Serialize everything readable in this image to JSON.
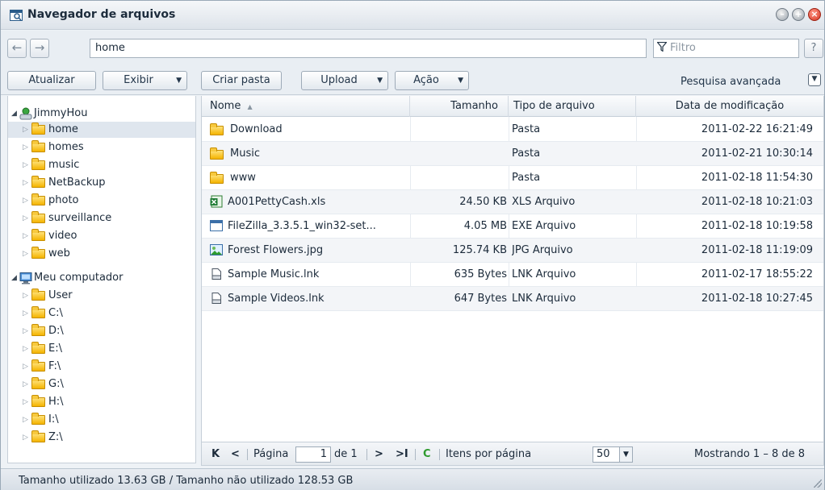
{
  "window": {
    "title": "Navegador de arquivos"
  },
  "address_bar": {
    "back_symbol": "←",
    "forward_symbol": "→",
    "path": "home",
    "filter_placeholder": "Filtro",
    "help_symbol": "?"
  },
  "toolbar": {
    "refresh_label": "Atualizar",
    "view_label": "Exibir",
    "new_folder_label": "Criar pasta",
    "upload_label": "Upload",
    "action_label": "Ação",
    "advanced_search_label": "Pesquisa avançada"
  },
  "tree": {
    "roots": [
      {
        "label": "JimmyHou",
        "icon": "network-user-icon",
        "children": [
          "home",
          "homes",
          "music",
          "NetBackup",
          "photo",
          "surveillance",
          "video",
          "web"
        ],
        "selected": "home"
      },
      {
        "label": "Meu computador",
        "icon": "computer-icon",
        "children": [
          "User",
          "C:\\",
          "D:\\",
          "E:\\",
          "F:\\",
          "G:\\",
          "H:\\",
          "I:\\",
          "Z:\\"
        ]
      }
    ]
  },
  "grid": {
    "columns": {
      "name": "Nome",
      "size": "Tamanho",
      "type": "Tipo de arquivo",
      "date": "Data de modificação"
    },
    "sort_indicator": "▲",
    "rows": [
      {
        "name": "Download",
        "size": "",
        "type": "Pasta",
        "date": "2011-02-22 16:21:49",
        "icon": "folder-icon"
      },
      {
        "name": "Music",
        "size": "",
        "type": "Pasta",
        "date": "2011-02-21 10:30:14",
        "icon": "folder-icon"
      },
      {
        "name": "www",
        "size": "",
        "type": "Pasta",
        "date": "2011-02-18 11:54:30",
        "icon": "folder-icon"
      },
      {
        "name": "A001PettyCash.xls",
        "size": "24.50 KB",
        "type": "XLS Arquivo",
        "date": "2011-02-18 10:21:03",
        "icon": "excel-file-icon"
      },
      {
        "name": "FileZilla_3.3.5.1_win32-set...",
        "size": "4.05 MB",
        "type": "EXE Arquivo",
        "date": "2011-02-18 10:19:58",
        "icon": "exe-file-icon"
      },
      {
        "name": "Forest Flowers.jpg",
        "size": "125.74 KB",
        "type": "JPG Arquivo",
        "date": "2011-02-18 11:19:09",
        "icon": "image-file-icon"
      },
      {
        "name": "Sample Music.lnk",
        "size": "635 Bytes",
        "type": "LNK Arquivo",
        "date": "2011-02-17 18:55:22",
        "icon": "shortcut-file-icon"
      },
      {
        "name": "Sample Videos.lnk",
        "size": "647 Bytes",
        "type": "LNK Arquivo",
        "date": "2011-02-18 10:27:45",
        "icon": "shortcut-file-icon"
      }
    ]
  },
  "pager": {
    "first_symbol": "K",
    "prev_symbol": "<",
    "page_label": "Página",
    "page_value": "1",
    "of_label": "de 1",
    "next_symbol": ">",
    "last_symbol": ">I",
    "refresh_symbol": "C",
    "per_page_label": "Itens por página",
    "per_page_value": "50",
    "display_text": "Mostrando 1 – 8 de 8"
  },
  "status": {
    "usage_text": "Tamanho utilizado 13.63 GB / Tamanho não utilizado 128.53 GB"
  },
  "colors": {
    "accent": "#2a5c8a",
    "folder": "#f4b400",
    "close_button": "#d5321f",
    "refresh_green": "#2e9b2e"
  }
}
